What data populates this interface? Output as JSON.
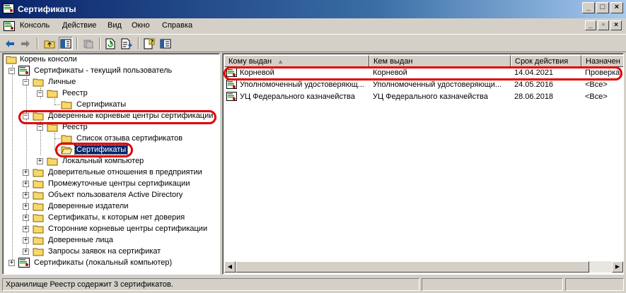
{
  "window": {
    "title": "Сертификаты",
    "buttons": [
      "_",
      "□",
      "×"
    ]
  },
  "menu": {
    "items": [
      "Консоль",
      "Действие",
      "Вид",
      "Окно",
      "Справка"
    ],
    "mdi_buttons": [
      "_",
      "▫",
      "×"
    ]
  },
  "toolbar": {
    "buttons": [
      "back-arrow",
      "forward-arrow",
      "up-folder",
      "show-hide-tree",
      "delete",
      "refresh",
      "export-list",
      "help",
      "properties"
    ]
  },
  "tree": {
    "root": "Корень консоли",
    "current_user": "Сертификаты - текущий пользователь",
    "personal": "Личные",
    "personal_registry": "Реестр",
    "personal_certs": "Сертификаты",
    "trusted_root": "Доверенные корневые центры сертификации",
    "trusted_root_registry": "Реестр",
    "crl": "Список отзыва сертификатов",
    "trusted_root_certs": "Сертификаты",
    "local_computer_store": "Локальный компьютер",
    "enterprise_trust": "Доверительные отношения в предприятии",
    "intermediate_ca": "Промежуточные центры сертификации",
    "ad_user_object": "Объект пользователя Active Directory",
    "trusted_publishers": "Доверенные издатели",
    "untrusted_certs": "Сертификаты, к которым нет доверия",
    "third_party_root": "Сторонние корневые центры сертификации",
    "trusted_people": "Доверенные лица",
    "cert_requests": "Запросы заявок на сертификат",
    "local_computer": "Сертификаты (локальный компьютер)"
  },
  "list": {
    "columns": [
      "Кому выдан",
      "Кем выдан",
      "Срок действия",
      "Назначен"
    ],
    "rows": [
      {
        "issued_to": "Корневой",
        "issued_by": "Корневой",
        "expires": "14.04.2021",
        "purpose": "Проверка"
      },
      {
        "issued_to": "Уполномоченный удостоверяющ...",
        "issued_by": "Уполномоченный удостоверяющи...",
        "expires": "24.05.2016",
        "purpose": "<Все>"
      },
      {
        "issued_to": "УЦ Федерального казначейства",
        "issued_by": "УЦ Федерального казначейства",
        "expires": "28.06.2018",
        "purpose": "<Все>"
      }
    ]
  },
  "status": {
    "text": "Хранилище Реестр содержит 3 сертификатов."
  },
  "colors": {
    "highlight": "#e00000",
    "title_start": "#0a246a",
    "selection": "#0a246a"
  }
}
